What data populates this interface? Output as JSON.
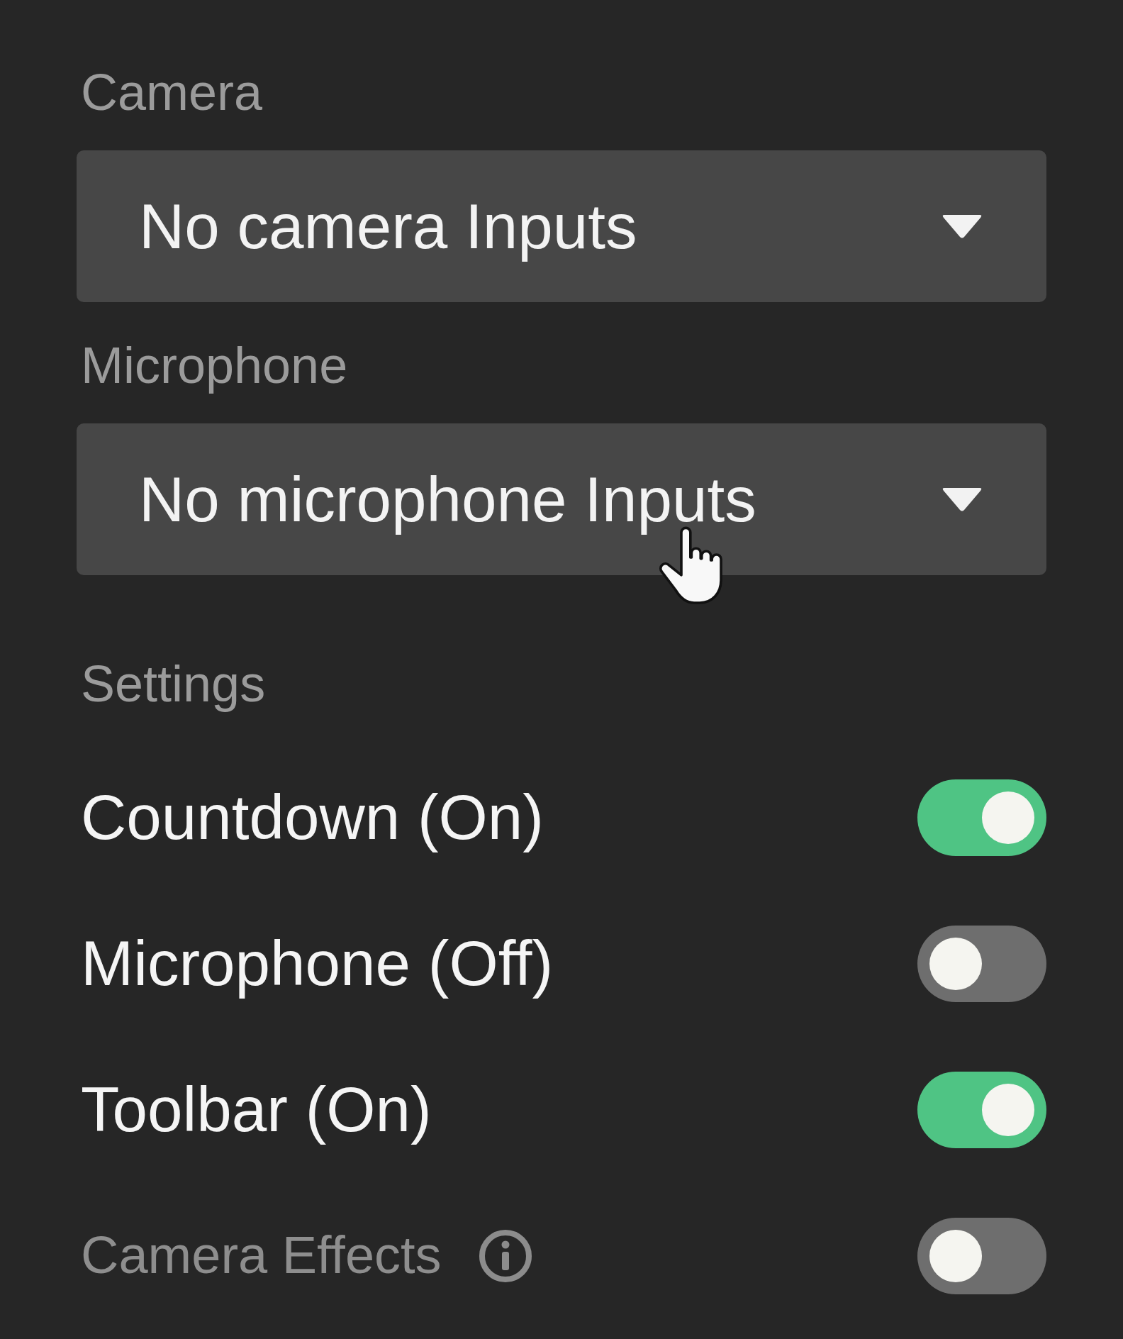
{
  "dropdowns": [
    {
      "label": "Camera",
      "value": "No camera Inputs"
    },
    {
      "label": "Microphone",
      "value": "No microphone Inputs"
    }
  ],
  "settings": {
    "heading": "Settings",
    "rows": [
      {
        "label": "Countdown (On)",
        "on": true,
        "disabled": false,
        "info": false
      },
      {
        "label": "Microphone (Off)",
        "on": false,
        "disabled": false,
        "info": false
      },
      {
        "label": "Toolbar (On)",
        "on": true,
        "disabled": false,
        "info": false
      },
      {
        "label": "Camera Effects",
        "on": false,
        "disabled": true,
        "info": true
      }
    ]
  }
}
